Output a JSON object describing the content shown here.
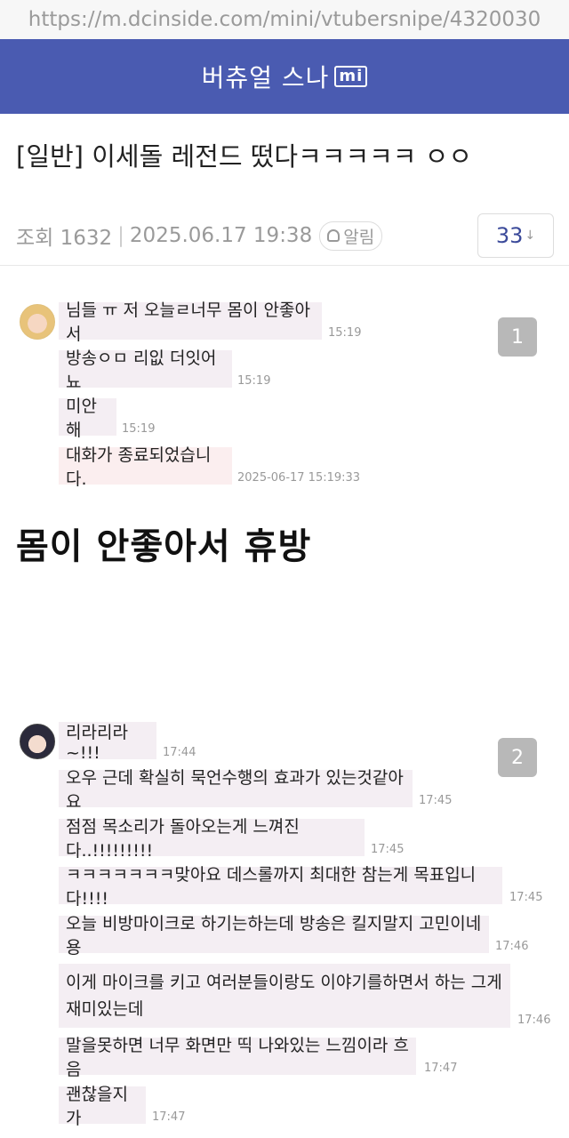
{
  "browser": {
    "url": "https://m.dcinside.com/mini/vtubersnipe/4320030"
  },
  "header": {
    "title": "버츄얼 스나",
    "badge": "mi"
  },
  "post": {
    "title": "[일반] 이세돌 레전드 떴다ㅋㅋㅋㅋㅋ ㅇㅇ",
    "views": "조회 1632",
    "datetime": "2025.06.17 19:38",
    "alarm_label": "알림",
    "comment_count": "33"
  },
  "chat1": {
    "badge": "1",
    "messages": [
      {
        "text": "님들 ㅠ 저 오늘ㄹ너무 몸이 안좋아서",
        "time": "15:19"
      },
      {
        "text": "방송ㅇㅁ 리잆 더잇어뇨",
        "time": "15:19"
      },
      {
        "text": "미안해",
        "time": "15:19"
      },
      {
        "text": "대화가 종료되었습니다.",
        "time": "2025-06-17 15:19:33"
      }
    ]
  },
  "caption": "몸이 안좋아서 휴방",
  "chat2": {
    "badge": "2",
    "messages": [
      {
        "text": "리라리라~!!!",
        "time": "17:44"
      },
      {
        "text": "오우 근데 확실히 묵언수행의 효과가 있는것같아요",
        "time": "17:45"
      },
      {
        "text": "점점 목소리가 돌아오는게 느껴진다..!!!!!!!!!",
        "time": "17:45"
      },
      {
        "text": "ㅋㅋㅋㅋㅋㅋㅋ맞아요 데스롤까지 최대한 참는게 목표입니다!!!!",
        "time": "17:45"
      },
      {
        "text": "오늘 비방마이크로 하기는하는데 방송은 킬지말지 고민이네용",
        "time": "17:46"
      },
      {
        "line1": "이게 마이크를 키고 여러분들이랑도 이야기를하면서 하는 그게",
        "line2": "재미있는데",
        "time": "17:46"
      },
      {
        "text": "말을못하면 너무 화면만 띡 나와있는 느낌이라 흐음",
        "time": "17:47"
      },
      {
        "text": "괜찮을지가",
        "time": "17:47"
      }
    ]
  }
}
